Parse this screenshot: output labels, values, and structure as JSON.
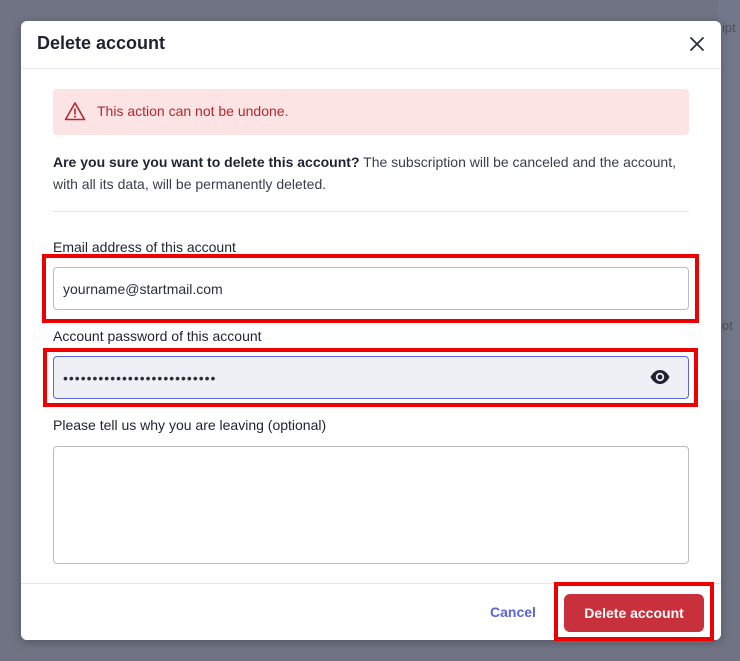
{
  "background": {
    "fragments": [
      "ipt",
      "ot"
    ]
  },
  "dialog": {
    "title": "Delete account",
    "close_icon": "close-icon",
    "alert": {
      "icon": "warning-triangle-icon",
      "text": "This action can not be undone."
    },
    "confirmation": {
      "bold": "Are you sure you want to delete this account?",
      "rest": " The subscription will be canceled and the account, with all its data, will be permanently deleted."
    },
    "email": {
      "label": "Email address of this account",
      "value": "yourname@startmail.com"
    },
    "password": {
      "label": "Account password of this account",
      "value": "••••••••••••••••••••••••••",
      "toggle_icon": "eye-icon"
    },
    "reason": {
      "label": "Please tell us why you are leaving (optional)",
      "value": ""
    },
    "footer": {
      "cancel_label": "Cancel",
      "delete_label": "Delete account"
    }
  },
  "colors": {
    "accent": "#5b63d6",
    "danger": "#c8303b",
    "alert_bg": "#fde4e4",
    "highlight": "#ee0000"
  }
}
